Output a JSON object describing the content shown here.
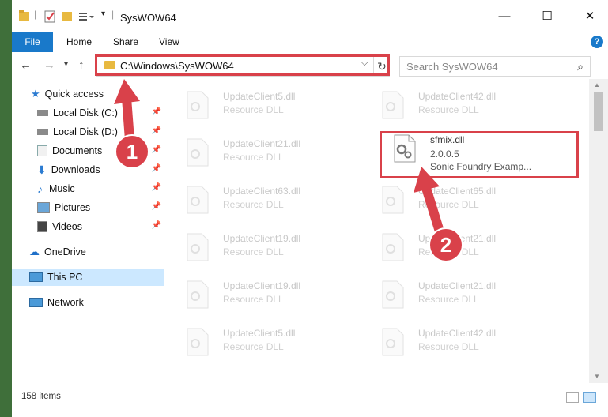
{
  "window": {
    "title": "SysWOW64",
    "controls": [
      "minimize-icon",
      "maximize-icon",
      "close-icon"
    ]
  },
  "ribbon": {
    "file_label": "File",
    "tabs": [
      "Home",
      "Share",
      "View"
    ],
    "help_label": "?"
  },
  "address": {
    "path": "C:\\Windows\\SysWOW64"
  },
  "search": {
    "placeholder": "Search SysWOW64"
  },
  "sidebar": {
    "items": [
      {
        "label": "Quick access",
        "icon": "star-icon"
      },
      {
        "label": "Local Disk (C:)",
        "icon": "drive-icon"
      },
      {
        "label": "Local Disk (D:)",
        "icon": "drive-icon"
      },
      {
        "label": "Documents",
        "icon": "documents-icon"
      },
      {
        "label": "Downloads",
        "icon": "download-icon"
      },
      {
        "label": "Music",
        "icon": "music-icon"
      },
      {
        "label": "Pictures",
        "icon": "pictures-icon"
      },
      {
        "label": "Videos",
        "icon": "videos-icon"
      },
      {
        "label": "OneDrive",
        "icon": "cloud-icon"
      },
      {
        "label": "This PC",
        "icon": "computer-icon"
      },
      {
        "label": "Network",
        "icon": "network-icon"
      }
    ]
  },
  "files": {
    "col1": [
      {
        "name": "UpdateClient5.dll",
        "desc": "Resource DLL"
      },
      {
        "name": "UpdateClient21.dll",
        "desc": "Resource DLL"
      },
      {
        "name": "UpdateClient63.dll",
        "desc": "Resource DLL"
      },
      {
        "name": "UpdateClient19.dll",
        "desc": "Resource DLL"
      },
      {
        "name": "UpdateClient19.dll",
        "desc": "Resource DLL"
      },
      {
        "name": "UpdateClient5.dll",
        "desc": "Resource DLL"
      }
    ],
    "col2": [
      {
        "name": "UpdateClient42.dll",
        "desc": "Resource DLL"
      },
      {
        "name": "sfmix.dll",
        "version": "2.0.0.5",
        "desc": "Sonic Foundry Examp..."
      },
      {
        "name": "UpdateClient65.dll",
        "desc": "Resource DLL"
      },
      {
        "name": "UpdateClient21.dll",
        "desc": "Resource DLL"
      },
      {
        "name": "UpdateClient21.dll",
        "desc": "Resource DLL"
      },
      {
        "name": "UpdateClient42.dll",
        "desc": "Resource DLL"
      }
    ]
  },
  "status": {
    "count": "158 items"
  },
  "annotations": {
    "badge1": "1",
    "badge2": "2",
    "color": "#d9414a"
  },
  "colors": {
    "accent": "#1979ca",
    "selected": "#cce8ff"
  }
}
